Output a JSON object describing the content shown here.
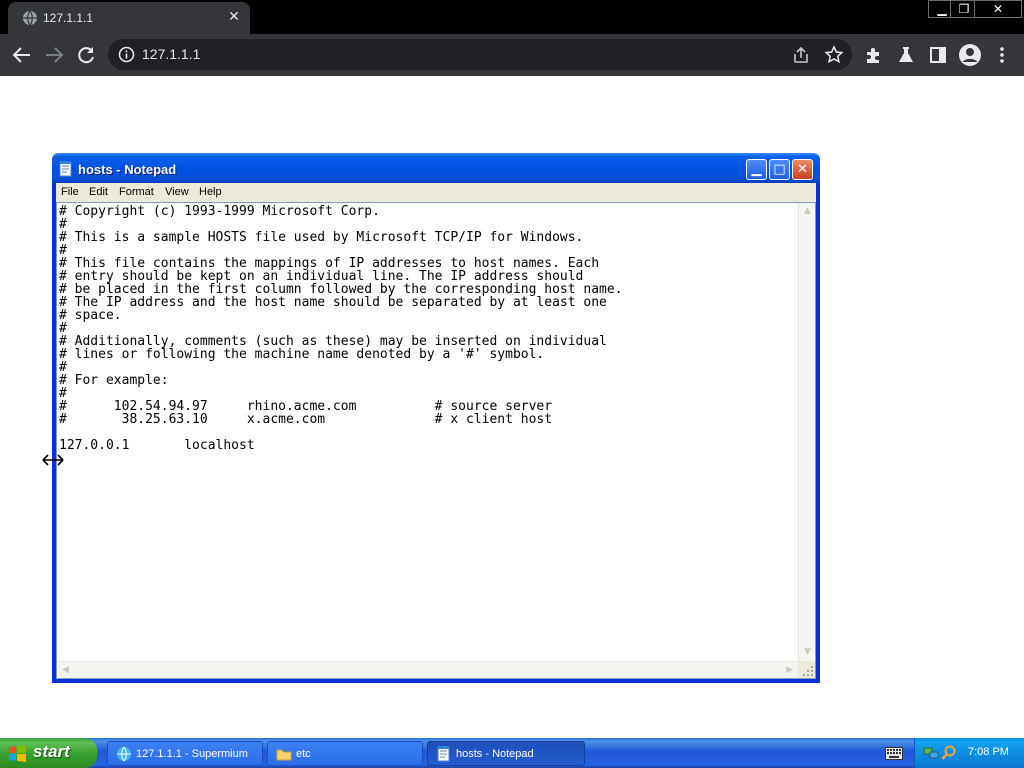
{
  "browser": {
    "tab_title": "127.1.1.1",
    "url": "127.1.1.1",
    "window_controls": [
      "minimize",
      "restore",
      "close"
    ]
  },
  "notepad": {
    "title": "hosts - Notepad",
    "menus": [
      "File",
      "Edit",
      "Format",
      "View",
      "Help"
    ],
    "content": "# Copyright (c) 1993-1999 Microsoft Corp.\n#\n# This is a sample HOSTS file used by Microsoft TCP/IP for Windows.\n#\n# This file contains the mappings of IP addresses to host names. Each\n# entry should be kept on an individual line. The IP address should\n# be placed in the first column followed by the corresponding host name.\n# The IP address and the host name should be separated by at least one\n# space.\n#\n# Additionally, comments (such as these) may be inserted on individual\n# lines or following the machine name denoted by a '#' symbol.\n#\n# For example:\n#\n#      102.54.94.97     rhino.acme.com          # source server\n#       38.25.63.10     x.acme.com              # x client host\n\n127.0.0.1       localhost"
  },
  "taskbar": {
    "start_label": "start",
    "tasks": [
      {
        "label": "127.1.1.1 - Supermium",
        "icon": "browser-icon"
      },
      {
        "label": "etc",
        "icon": "folder-icon"
      },
      {
        "label": "hosts - Notepad",
        "icon": "notepad-icon",
        "active": true
      }
    ],
    "clock": "7:08 PM"
  },
  "colors": {
    "chrome_dark": "#35363a",
    "xp_title_blue": "#0053e3",
    "xp_taskbar_blue": "#2157d7",
    "xp_start_green": "#37a02c"
  }
}
